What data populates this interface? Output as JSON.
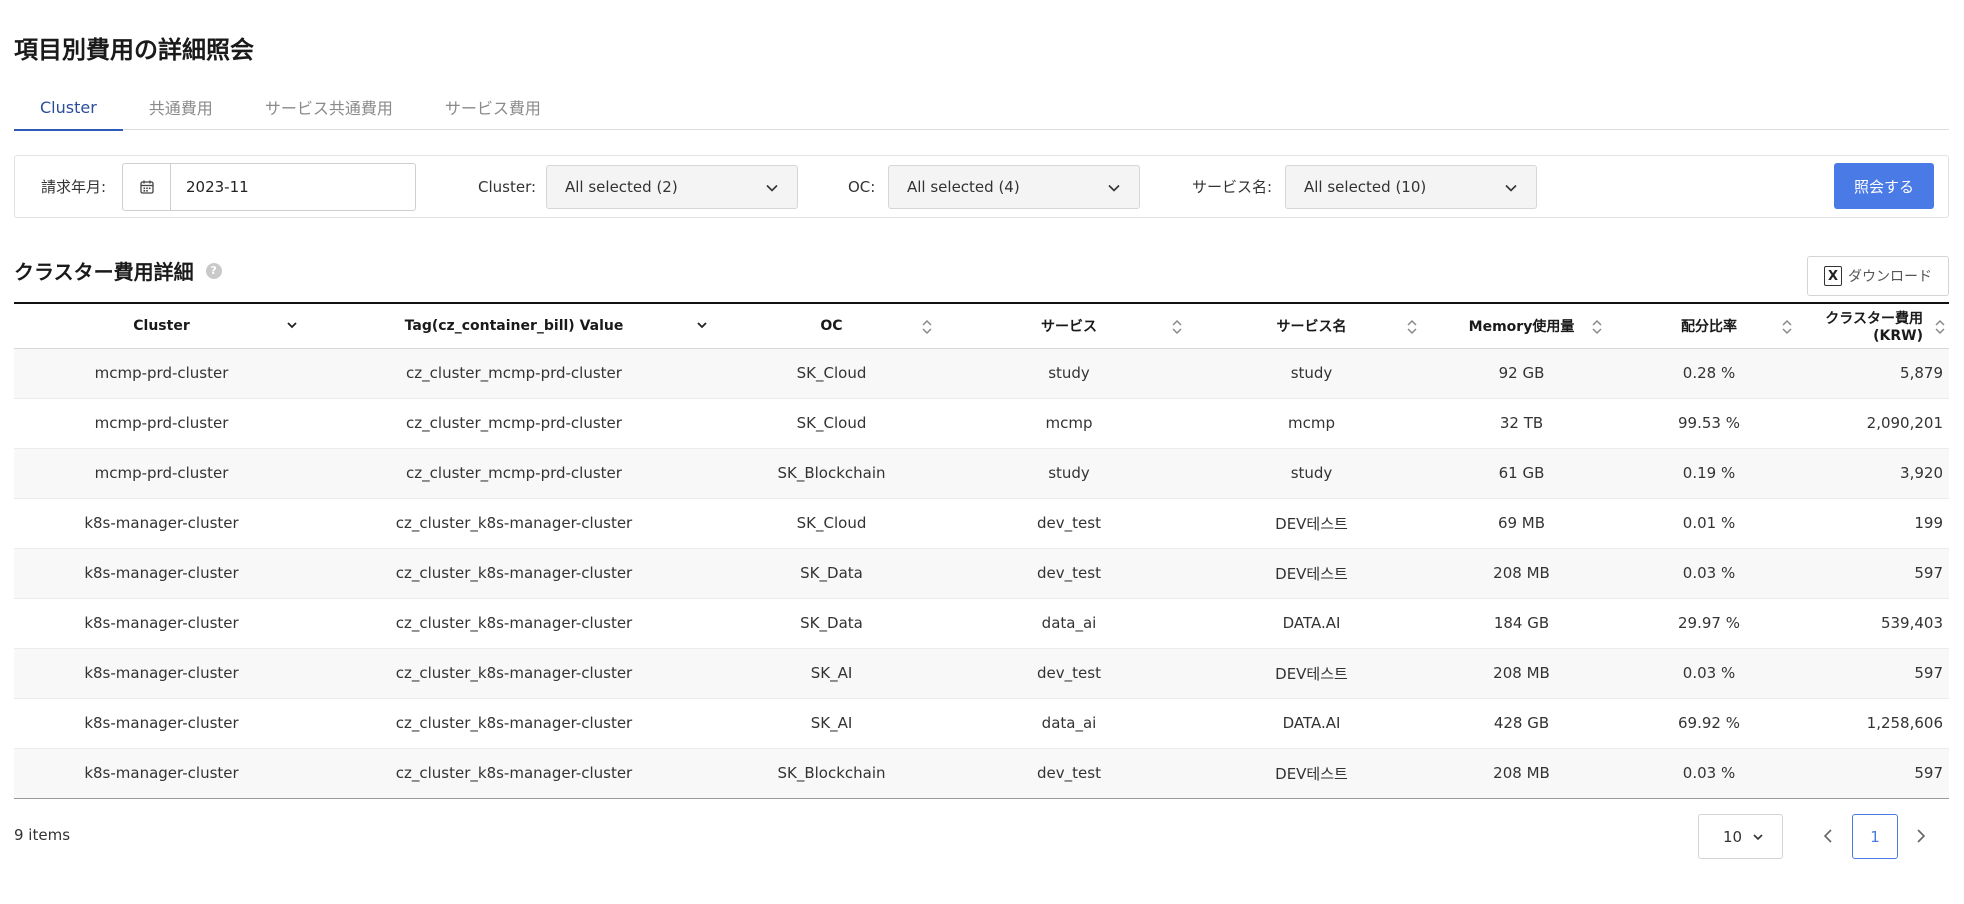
{
  "page": {
    "title": "項目別費用の詳細照会"
  },
  "tabs": [
    {
      "label": "Cluster",
      "active": true
    },
    {
      "label": "共通費用",
      "active": false
    },
    {
      "label": "サービス共通費用",
      "active": false
    },
    {
      "label": "サービス費用",
      "active": false
    }
  ],
  "filters": {
    "billing_month_label": "請求年月:",
    "billing_month_value": "2023-11",
    "cluster_label": "Cluster:",
    "cluster_value": "All selected (2)",
    "oc_label": "OC:",
    "oc_value": "All selected (4)",
    "service_name_label": "サービス名:",
    "service_name_value": "All selected (10)",
    "search_button": "照会する"
  },
  "section": {
    "title": "クラスター費用詳細",
    "help_icon": "?",
    "download_button": "ダウンロード"
  },
  "table": {
    "columns": [
      "Cluster",
      "Tag(cz_container_bill) Value",
      "OC",
      "サービス",
      "サービス名",
      "Memory使用量",
      "配分比率",
      "クラスター費用 (KRW)"
    ],
    "rows": [
      [
        "mcmp-prd-cluster",
        "cz_cluster_mcmp-prd-cluster",
        "SK_Cloud",
        "study",
        "study",
        "92 GB",
        "0.28 %",
        "5,879"
      ],
      [
        "mcmp-prd-cluster",
        "cz_cluster_mcmp-prd-cluster",
        "SK_Cloud",
        "mcmp",
        "mcmp",
        "32 TB",
        "99.53 %",
        "2,090,201"
      ],
      [
        "mcmp-prd-cluster",
        "cz_cluster_mcmp-prd-cluster",
        "SK_Blockchain",
        "study",
        "study",
        "61 GB",
        "0.19 %",
        "3,920"
      ],
      [
        "k8s-manager-cluster",
        "cz_cluster_k8s-manager-cluster",
        "SK_Cloud",
        "dev_test",
        "DEV테스트",
        "69 MB",
        "0.01 %",
        "199"
      ],
      [
        "k8s-manager-cluster",
        "cz_cluster_k8s-manager-cluster",
        "SK_Data",
        "dev_test",
        "DEV테스트",
        "208 MB",
        "0.03 %",
        "597"
      ],
      [
        "k8s-manager-cluster",
        "cz_cluster_k8s-manager-cluster",
        "SK_Data",
        "data_ai",
        "DATA.AI",
        "184 GB",
        "29.97 %",
        "539,403"
      ],
      [
        "k8s-manager-cluster",
        "cz_cluster_k8s-manager-cluster",
        "SK_AI",
        "dev_test",
        "DEV테스트",
        "208 MB",
        "0.03 %",
        "597"
      ],
      [
        "k8s-manager-cluster",
        "cz_cluster_k8s-manager-cluster",
        "SK_AI",
        "data_ai",
        "DATA.AI",
        "428 GB",
        "69.92 %",
        "1,258,606"
      ],
      [
        "k8s-manager-cluster",
        "cz_cluster_k8s-manager-cluster",
        "SK_Blockchain",
        "dev_test",
        "DEV테스트",
        "208 MB",
        "0.03 %",
        "597"
      ]
    ]
  },
  "pagination": {
    "items_count": "9 items",
    "page_size": "10",
    "current_page": "1"
  }
}
